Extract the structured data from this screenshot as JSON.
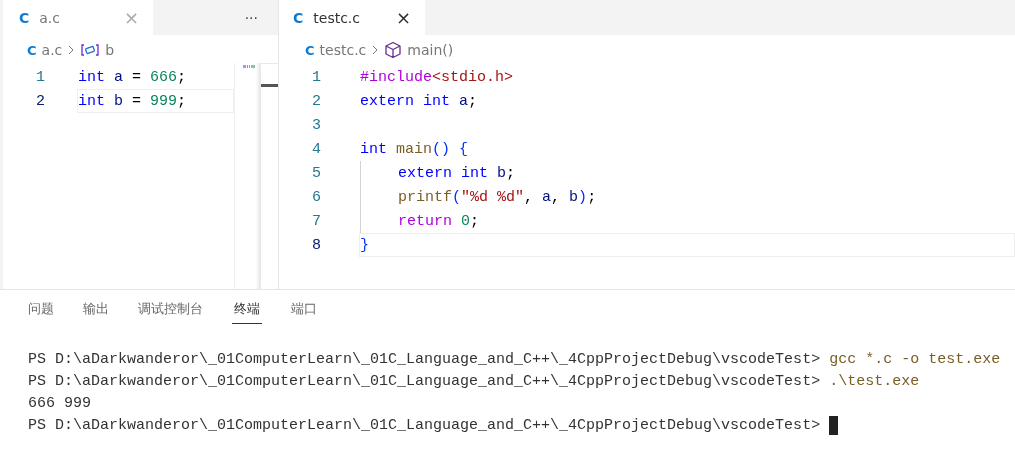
{
  "editors": [
    {
      "tab": {
        "label": "a.c",
        "icon": "C",
        "close": "×",
        "selected": true
      },
      "more": "···",
      "breadcrumb": {
        "icon": "C",
        "file": "a.c",
        "kind": "variable",
        "symbol": "b"
      },
      "minimap": true,
      "lines": [
        {
          "number": "1",
          "current": false,
          "indented": false,
          "tokens": [
            {
              "text": "int ",
              "kind": "keyword"
            },
            {
              "text": "a",
              "kind": "variable"
            },
            {
              "text": " = ",
              "kind": "plain"
            },
            {
              "text": "666",
              "kind": "number"
            },
            {
              "text": ";",
              "kind": "plain"
            }
          ]
        },
        {
          "number": "2",
          "current": true,
          "indented": false,
          "tokens": [
            {
              "text": "int ",
              "kind": "keyword"
            },
            {
              "text": "b",
              "kind": "variable"
            },
            {
              "text": " = ",
              "kind": "plain"
            },
            {
              "text": "999",
              "kind": "number"
            },
            {
              "text": ";",
              "kind": "plain"
            }
          ]
        }
      ]
    },
    {
      "tab": {
        "label": "testc.c",
        "icon": "C",
        "close": "×",
        "selected": true
      },
      "breadcrumb": {
        "icon": "C",
        "file": "testc.c",
        "kind": "function",
        "symbol": "main()"
      },
      "minimap": false,
      "lines": [
        {
          "number": "1",
          "current": false,
          "indented": false,
          "tokens": [
            {
              "text": "#include",
              "kind": "control"
            },
            {
              "text": "<stdio.h>",
              "kind": "string"
            }
          ]
        },
        {
          "number": "2",
          "current": false,
          "indented": false,
          "tokens": [
            {
              "text": "extern int ",
              "kind": "keyword"
            },
            {
              "text": "a",
              "kind": "variable"
            },
            {
              "text": ";",
              "kind": "plain"
            }
          ]
        },
        {
          "number": "3",
          "current": false
        },
        {
          "number": "4",
          "current": false,
          "indented": false,
          "tokens": [
            {
              "text": "int ",
              "kind": "keyword"
            },
            {
              "text": "main",
              "kind": "function"
            },
            {
              "text": "() {",
              "kind": "bracket"
            }
          ]
        },
        {
          "number": "5",
          "current": false,
          "indented": true,
          "tokens": [
            {
              "text": "extern int ",
              "kind": "keyword"
            },
            {
              "text": "b",
              "kind": "variable"
            },
            {
              "text": ";",
              "kind": "plain"
            }
          ]
        },
        {
          "number": "6",
          "current": false,
          "indented": true,
          "tokens": [
            {
              "text": "printf",
              "kind": "function"
            },
            {
              "text": "(",
              "kind": "bracket"
            },
            {
              "text": "\"%d %d\"",
              "kind": "string"
            },
            {
              "text": ", ",
              "kind": "plain"
            },
            {
              "text": "a",
              "kind": "variable"
            },
            {
              "text": ", ",
              "kind": "plain"
            },
            {
              "text": "b",
              "kind": "variable"
            },
            {
              "text": ")",
              "kind": "bracket"
            },
            {
              "text": ";",
              "kind": "plain"
            }
          ]
        },
        {
          "number": "7",
          "current": false,
          "indented": true,
          "tokens": [
            {
              "text": "return ",
              "kind": "control"
            },
            {
              "text": "0",
              "kind": "number"
            },
            {
              "text": ";",
              "kind": "plain"
            }
          ]
        },
        {
          "number": "8",
          "current": true,
          "indented": false,
          "tokens": [
            {
              "text": "}",
              "kind": "bracket"
            }
          ]
        }
      ]
    }
  ],
  "panel": {
    "tabs": [
      {
        "label": "问题",
        "selected": false
      },
      {
        "label": "输出",
        "selected": false
      },
      {
        "label": "调试控制台",
        "selected": false
      },
      {
        "label": "终端",
        "selected": true
      },
      {
        "label": "端口",
        "selected": false
      }
    ],
    "terminal": [
      {
        "prompt": "PS D:\\aDarkwanderor\\_01ComputerLearn\\_01C_Language_and_C++\\_4CppProjectDebug\\vscodeTest>",
        "command": "gcc *.c -o test.exe"
      },
      {
        "prompt": "PS D:\\aDarkwanderor\\_01ComputerLearn\\_01C_Language_and_C++\\_4CppProjectDebug\\vscodeTest>",
        "command": ".\\test.exe"
      },
      {
        "output": "666 999"
      },
      {
        "prompt": "PS D:\\aDarkwanderor\\_01ComputerLearn\\_01C_Language_and_C++\\_4CppProjectDebug\\vscodeTest>",
        "cursor": true
      }
    ]
  }
}
